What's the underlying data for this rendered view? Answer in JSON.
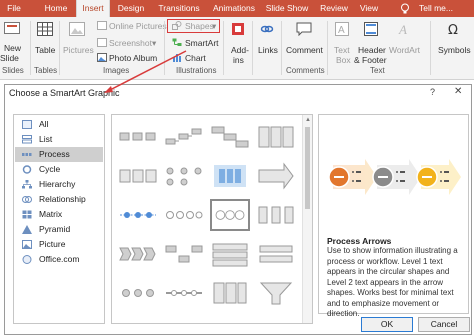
{
  "ribbon_tabs": [
    "File",
    "Home",
    "Insert",
    "Design",
    "Transitions",
    "Animations",
    "Slide Show",
    "Review",
    "View",
    "Tell me..."
  ],
  "ribbon": {
    "new_slide": [
      "New",
      "Slide"
    ],
    "table": "Table",
    "pictures": "Pictures",
    "online_pictures": "Online Pictures",
    "screenshot": "Screenshot",
    "photo_album": "Photo Album",
    "shapes": "Shapes",
    "smartart": "SmartArt",
    "chart": "Chart",
    "addins": [
      "Add-",
      "ins"
    ],
    "links": "Links",
    "comment": "Comment",
    "text_box": [
      "Text",
      "Box"
    ],
    "header_footer": [
      "Header",
      "& Footer"
    ],
    "wordart": "WordArt",
    "symbols": "Symbols",
    "groups": {
      "slides": "Slides",
      "tables": "Tables",
      "images": "Images",
      "illustrations": "Illustrations",
      "comments": "Comments",
      "text": "Text"
    }
  },
  "dialog": {
    "title": "Choose a SmartArt Graphic",
    "help": "?",
    "close": "✕",
    "categories": [
      {
        "label": "All",
        "icon": "all-icon"
      },
      {
        "label": "List",
        "icon": "list-icon"
      },
      {
        "label": "Process",
        "icon": "process-icon",
        "selected": true
      },
      {
        "label": "Cycle",
        "icon": "cycle-icon"
      },
      {
        "label": "Hierarchy",
        "icon": "hierarchy-icon"
      },
      {
        "label": "Relationship",
        "icon": "relationship-icon"
      },
      {
        "label": "Matrix",
        "icon": "matrix-icon"
      },
      {
        "label": "Pyramid",
        "icon": "pyramid-icon"
      },
      {
        "label": "Picture",
        "icon": "picture-icon"
      },
      {
        "label": "Office.com",
        "icon": "office-icon"
      }
    ],
    "preview_title": "Process Arrows",
    "preview_description": "Use to show information illustrating a process or workflow. Level 1 text appears in the circular shapes and Level 2 text appears in the arrow shapes. Works best for minimal text and to emphasize movement or direction.",
    "ok": "OK",
    "cancel": "Cancel",
    "colors": {
      "accent": "#c9513a",
      "orange_circle": "#e2762d",
      "gray_circle": "#8b8b8b",
      "gold_circle": "#f2b21b",
      "selection": "#cfcfcf"
    }
  }
}
